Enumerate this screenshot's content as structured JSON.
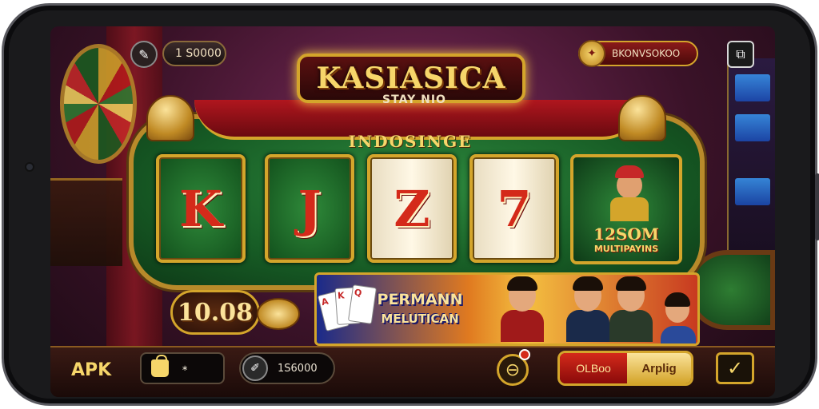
{
  "hud": {
    "left_icon": "✎",
    "coins_value": "1 S0000",
    "right_label": "BKONVSOKOO",
    "right_coin_icon": "✦",
    "menu_icon": "⧉"
  },
  "title": {
    "main": "KASIASICA",
    "sub": "STAY NIO",
    "headline": "INDOSINGE"
  },
  "reels": {
    "symbols": [
      "K",
      "J",
      "Z",
      "7"
    ],
    "promo_amount": "12SOM",
    "promo_sub": "MULTIPAYINS"
  },
  "win": {
    "amount": "10.08"
  },
  "banner": {
    "title_line1": "PERMANN",
    "title_line2": "MELUTICAN",
    "card_labels": [
      "A",
      "K",
      "Q"
    ]
  },
  "bottom": {
    "apk_label": "APK",
    "bag_value": "∗",
    "bet_icon": "✐",
    "bet_value": "1S6000",
    "button_left": "OLBoo",
    "button_right": "Arplig",
    "check_icon": "✓",
    "spin_icon": "⊖"
  }
}
